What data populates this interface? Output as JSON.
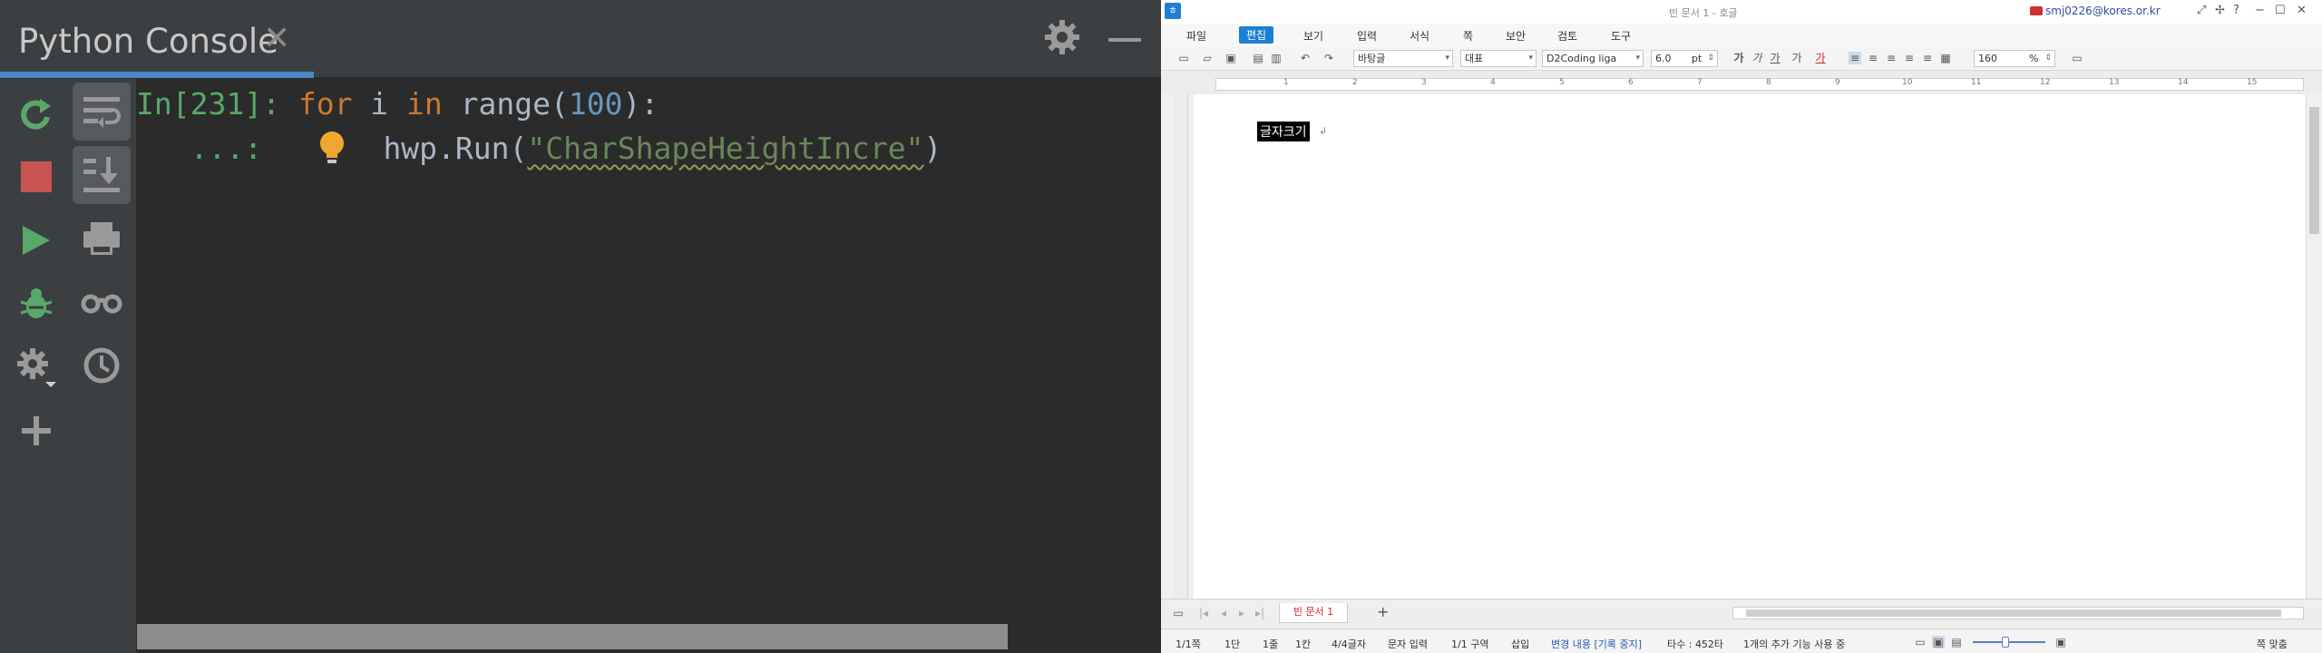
{
  "console": {
    "title": "Python Console",
    "close_glyph": "✕",
    "colors": {
      "background": "#2b2b2b",
      "panel": "#3c3f41",
      "tab_underline": "#4a88c7",
      "green": "#59a869",
      "red": "#c75450"
    },
    "toolbar_left": [
      "rerun-icon",
      "stop-icon",
      "run-icon",
      "debug-icon",
      "settings-icon",
      "add-icon"
    ],
    "toolbar_right": [
      "soft-wrap-icon",
      "scroll-to-end-icon",
      "print-icon",
      "view-variables-icon",
      "history-icon"
    ],
    "lines": [
      {
        "prompt": "In[231]:",
        "kw1": "for",
        "var": " i ",
        "kw2": "in",
        "fn": " range(",
        "num": "100",
        "end": "):"
      },
      {
        "prompt": "   ...:",
        "pre": "hwp.Run(",
        "str": "\"CharShapeHeightIncre\"",
        "end": ")"
      }
    ]
  },
  "hwp": {
    "app_icon": "ㅎ",
    "title": "빈 문서 1 - 호글",
    "user": "smj0226@kores.or.kr",
    "window_buttons": [
      "⤢",
      "✢",
      "?",
      "−",
      "☐",
      "✕"
    ],
    "menu": [
      {
        "label": "파일"
      },
      {
        "label": "편집",
        "active": true
      },
      {
        "label": "보기"
      },
      {
        "label": "입력"
      },
      {
        "label": "서식"
      },
      {
        "label": "쪽"
      },
      {
        "label": "보안"
      },
      {
        "label": "검토"
      },
      {
        "label": "도구"
      }
    ],
    "toolbar": {
      "style": "바탕글",
      "lang": "대표",
      "font": "D2Coding liga",
      "size": "6.0",
      "unit": "pt",
      "zoom": "160",
      "zoom_unit": "%",
      "char_buttons": [
        "가",
        "가",
        "가",
        "가",
        "가"
      ]
    },
    "ruler_numbers": [
      "1",
      "2",
      "3",
      "4",
      "5",
      "6",
      "7",
      "8",
      "9",
      "10",
      "11",
      "12",
      "13",
      "14",
      "15"
    ],
    "document": {
      "selected_text": "글자크기",
      "return_mark": "↲"
    },
    "doc_tab": "빈 문서 1",
    "status": {
      "page": "1/1쪽",
      "column": "1단",
      "line": "1줄",
      "cell": "1칸",
      "chars": "4/4글자",
      "mode": "문자 입력",
      "section": "1/1 구역",
      "insert": "삽입",
      "track_changes": "변경 내용 [기록 중지]",
      "typing": "타수 : 452타",
      "extra": "1개의 추가 기능 사용 중",
      "fit": "쪽 맞춤",
      "zoom_level": 0.45
    }
  }
}
